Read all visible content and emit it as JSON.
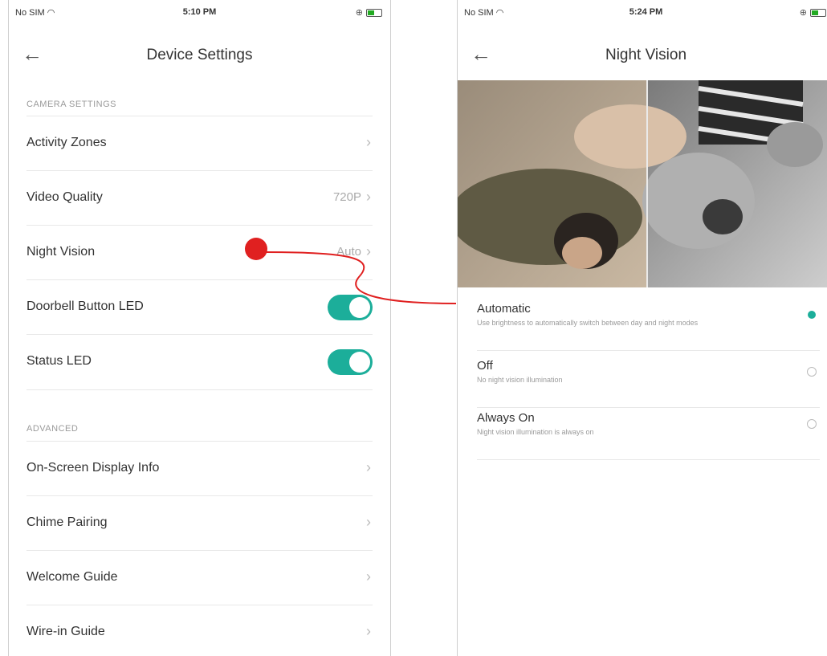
{
  "left_screen": {
    "status": {
      "carrier": "No SIM",
      "time": "5:10 PM"
    },
    "nav": {
      "back": "←",
      "title": "Device Settings"
    },
    "camera_section": "CAMERA SETTINGS",
    "camera_items": [
      {
        "label": "Activity Zones",
        "value": "",
        "chevron": "›"
      },
      {
        "label": "Video Quality",
        "value": "720P",
        "chevron": "›"
      },
      {
        "label": "Night Vision",
        "value": "Auto",
        "chevron": "›"
      }
    ],
    "toggles": [
      {
        "label": "Doorbell Button LED",
        "on": true
      },
      {
        "label": "Status LED",
        "on": true
      }
    ],
    "advanced_section": "ADVANCED",
    "advanced_items": [
      {
        "label": "On-Screen Display Info",
        "chevron": "›"
      },
      {
        "label": "Chime Pairing",
        "chevron": "›"
      },
      {
        "label": "Welcome Guide",
        "chevron": "›"
      },
      {
        "label": "Wire-in Guide",
        "chevron": "›"
      }
    ]
  },
  "right_screen": {
    "status": {
      "carrier": "No SIM",
      "time": "5:24 PM"
    },
    "nav": {
      "back": "←",
      "title": "Night Vision"
    },
    "options": [
      {
        "title": "Automatic",
        "desc": "Use brightness to automatically switch between day and night modes",
        "selected": true
      },
      {
        "title": "Off",
        "desc": "No night vision illumination",
        "selected": false
      },
      {
        "title": "Always On",
        "desc": "Night vision illumination is always on",
        "selected": false
      }
    ]
  },
  "colors": {
    "accent": "#1cae9a",
    "annotation": "#e02020"
  }
}
